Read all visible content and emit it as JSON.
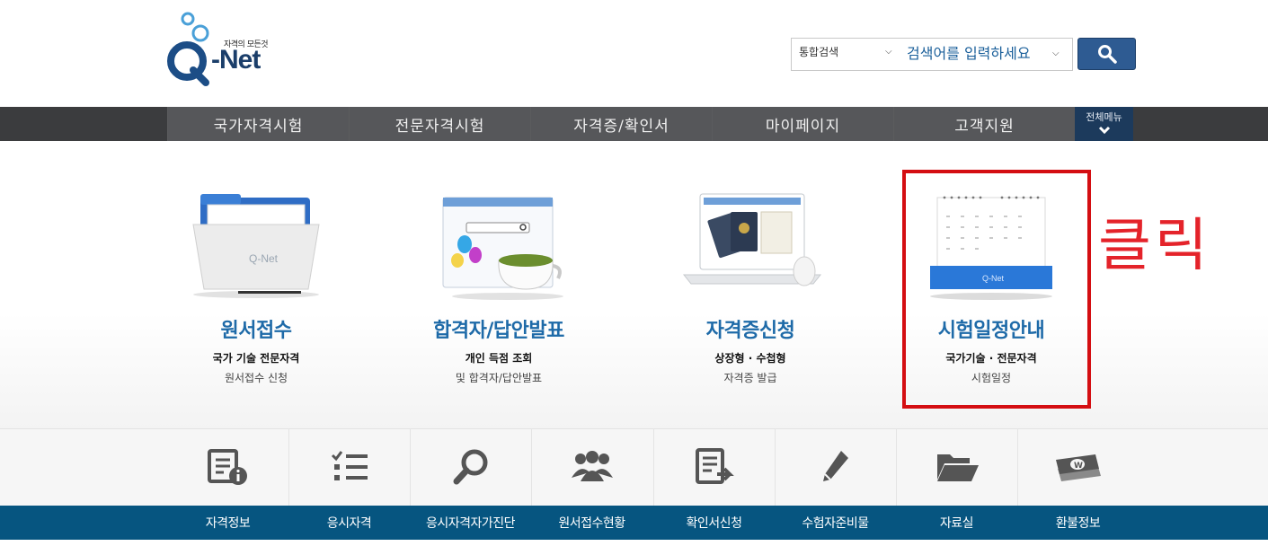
{
  "header": {
    "logo_tagline": "자격의 모든것",
    "logo_text": "-Net",
    "search_scope": "통합검색",
    "search_placeholder": "검색어를 입력하세요"
  },
  "gnb": {
    "items": [
      {
        "label": "국가자격시험"
      },
      {
        "label": "전문자격시험"
      },
      {
        "label": "자격증/확인서"
      },
      {
        "label": "마이페이지"
      },
      {
        "label": "고객지원"
      }
    ],
    "all_menu_label": "전체메뉴"
  },
  "cards": [
    {
      "title": "원서접수",
      "sub1": "국가 기술 전문자격",
      "sub2": "원서접수 신청",
      "icon": "folder-icon"
    },
    {
      "title": "합격자/답안발표",
      "sub1": "개인 득점 조회",
      "sub2": "및 합격자/답안발표",
      "icon": "browser-coffee-icon"
    },
    {
      "title": "자격증신청",
      "sub1": "상장형 · 수첩형",
      "sub2": "자격증 발급",
      "icon": "passport-laptop-icon"
    },
    {
      "title": "시험일정안내",
      "sub1": "국가기술 · 전문자격",
      "sub2": "시험일정",
      "icon": "calendar-icon"
    }
  ],
  "annotation": "클릭",
  "quick_menu": [
    {
      "label": "자격정보",
      "icon": "document-info-icon"
    },
    {
      "label": "응시자격",
      "icon": "checklist-icon"
    },
    {
      "label": "응시자격자가진단",
      "icon": "magnifier-icon"
    },
    {
      "label": "원서접수현황",
      "icon": "people-icon"
    },
    {
      "label": "확인서신청",
      "icon": "document-arrow-icon"
    },
    {
      "label": "수험자준비물",
      "icon": "pencil-icon"
    },
    {
      "label": "자료실",
      "icon": "folder-open-icon"
    },
    {
      "label": "환불정보",
      "icon": "money-icon"
    }
  ],
  "colors": {
    "brand_blue": "#1e6aa8",
    "nav_dark": "#3b3c3e",
    "footer_bar": "#065580",
    "highlight_red": "#d40e12"
  }
}
